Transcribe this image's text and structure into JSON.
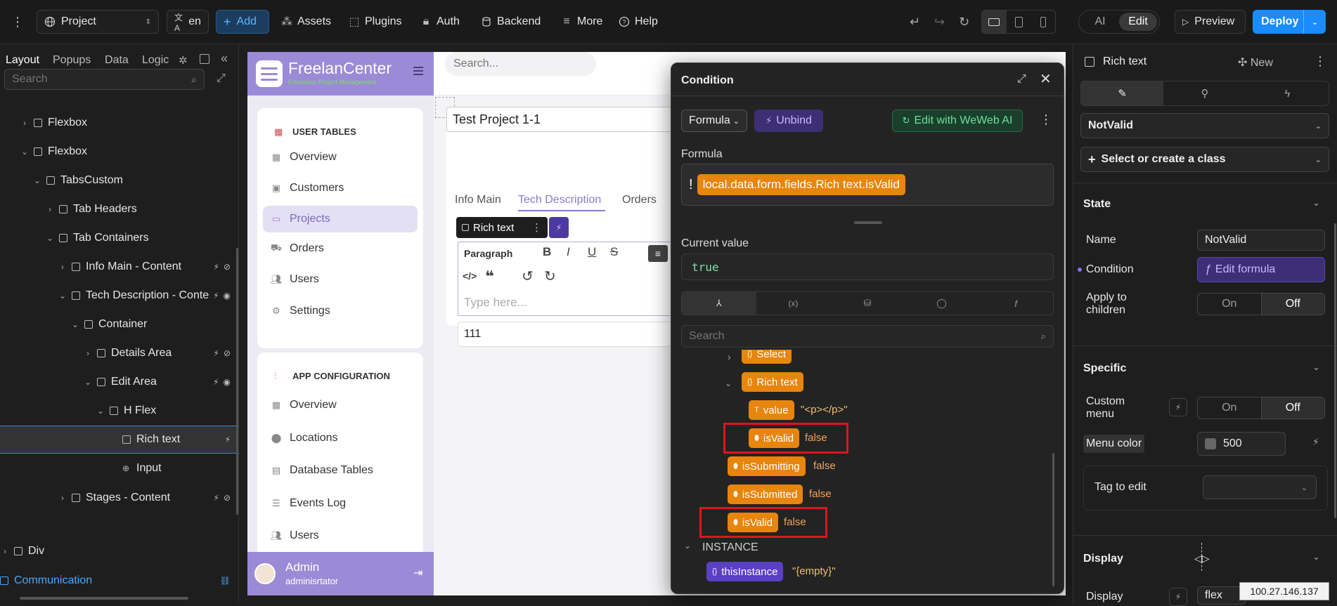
{
  "topbar": {
    "project": "Project",
    "lang": "en",
    "add": "Add",
    "assets": "Assets",
    "plugins": "Plugins",
    "auth": "Auth",
    "backend": "Backend",
    "more": "More",
    "help": "Help",
    "ai": "AI",
    "edit": "Edit",
    "preview": "Preview",
    "deploy": "Deploy"
  },
  "leftpanel": {
    "tabs": [
      "Layout",
      "Popups",
      "Data",
      "Logic"
    ],
    "search_placeholder": "Search",
    "tree": [
      {
        "label": "Flexbox",
        "depth": 0,
        "chev": "right"
      },
      {
        "label": "Flexbox",
        "depth": 0,
        "chev": "down"
      },
      {
        "label": "TabsCustom",
        "depth": 1,
        "chev": "down"
      },
      {
        "label": "Tab Headers",
        "depth": 2,
        "chev": "right"
      },
      {
        "label": "Tab Containers",
        "depth": 2,
        "chev": "down"
      },
      {
        "label": "Info Main - Content",
        "depth": 3,
        "chev": "right"
      },
      {
        "label": "Tech Description - Conte",
        "depth": 3,
        "chev": "down"
      },
      {
        "label": "Container",
        "depth": 4,
        "chev": "down"
      },
      {
        "label": "Details Area",
        "depth": 5,
        "chev": "right"
      },
      {
        "label": "Edit Area",
        "depth": 5,
        "chev": "down"
      },
      {
        "label": "H Flex",
        "depth": 6,
        "chev": "down"
      },
      {
        "label": "Rich text",
        "depth": 7,
        "chev": ""
      },
      {
        "label": "Input",
        "depth": 7,
        "chev": ""
      },
      {
        "label": "Stages - Content",
        "depth": 3,
        "chev": "right"
      }
    ],
    "div_label": "Div",
    "communication_label": "Communication"
  },
  "app": {
    "brand": "FreelanCenter",
    "brand_sub": "Freelance Project Management",
    "search_placeholder": "Search...",
    "section_user_tables": "USER TABLES",
    "nav_user": [
      "Overview",
      "Customers",
      "Projects",
      "Orders",
      "Users",
      "Settings"
    ],
    "section_app_config": "APP CONFIGURATION",
    "nav_config": [
      "Overview",
      "Locations",
      "Database Tables",
      "Events Log",
      "Users"
    ],
    "admin_name": "Admin",
    "admin_sub": "adminisrtator",
    "project_title": "Test Project 1-1",
    "tabs": [
      "Info Main",
      "Tech Description",
      "Orders"
    ],
    "richtext_badge": "Rich text",
    "editor_paragraph": "Paragraph",
    "editor_placeholder": "Type here...",
    "input_value": "111"
  },
  "modal": {
    "title": "Condition",
    "formula_btn": "Formula",
    "unbind_btn": "Unbind",
    "weweb_ai_btn": "Edit with WeWeb AI",
    "formula_label": "Formula",
    "formula_not": "!",
    "formula_expr": "local.data.form.fields.Rich text.isValid",
    "current_value_label": "Current value",
    "current_value": "true",
    "search_placeholder": "Search",
    "tree": {
      "select": "Select",
      "rich_text": "Rich text",
      "value_key": "value",
      "value_val": "\"<p></p>\"",
      "isvalid_key": "isValid",
      "isvalid_val": "false",
      "issubmitting_key": "isSubmitting",
      "issubmitting_val": "false",
      "issubmitted_key": "isSubmitted",
      "issubmitted_val": "false",
      "isvalid2_key": "isValid",
      "isvalid2_val": "false",
      "instance_label": "INSTANCE",
      "thisinstance_key": "thisInstance",
      "thisinstance_val": "\"{empty}\""
    }
  },
  "rightpanel": {
    "element": "Rich text",
    "new": "New",
    "state_value": "NotValid",
    "class_placeholder": "Select or create a class",
    "state_section": "State",
    "name_label": "Name",
    "name_value": "NotValid",
    "condition_label": "Condition",
    "condition_btn": "Edit formula",
    "apply_label": "Apply to children",
    "on": "On",
    "off": "Off",
    "specific_section": "Specific",
    "custom_menu_label": "Custom menu",
    "menu_color_label": "Menu color",
    "menu_color_value": "500",
    "tag_label": "Tag to edit",
    "display_section": "Display",
    "display_label": "Display",
    "display_value": "flex",
    "ip_tooltip": "100.27.146.137"
  },
  "colors": {
    "accent_blue": "#1a8cff",
    "highlight_red": "#e0141e",
    "chip_orange": "#e8850c",
    "chip_purple": "#5b3fc4",
    "app_purple": "#9b8ad6"
  }
}
